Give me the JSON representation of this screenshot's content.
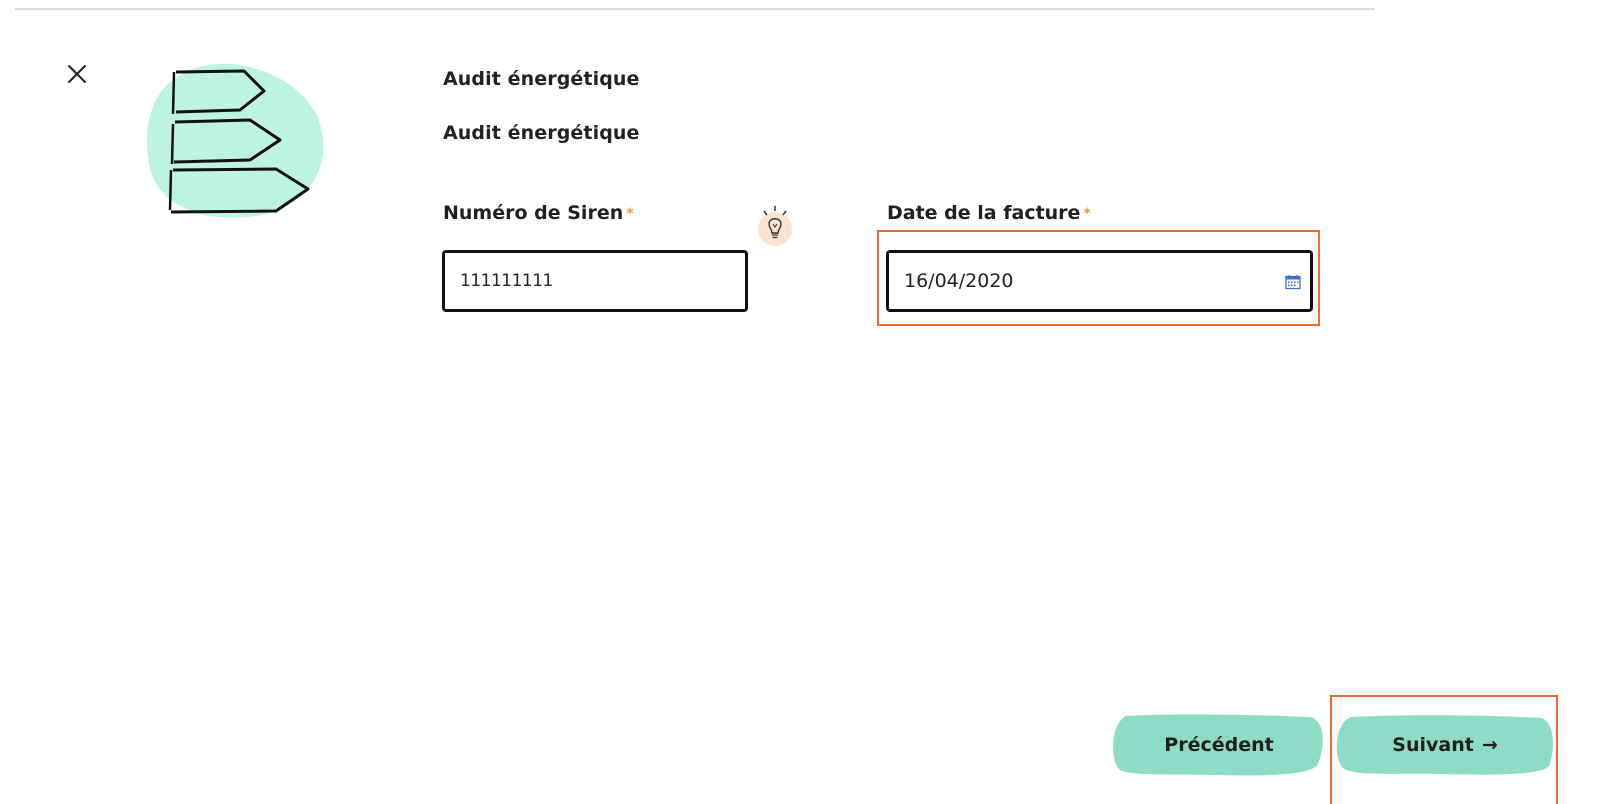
{
  "header": {
    "subtitle_primary": "Audit énergétique",
    "subtitle_secondary": "Audit énergétique"
  },
  "form": {
    "siren": {
      "label": "Numéro de Siren",
      "required_marker": "*",
      "value": "111111111"
    },
    "invoice_date": {
      "label": "Date de la facture",
      "required_marker": "*",
      "value": "16/04/2020"
    }
  },
  "footer": {
    "previous_label": "Précédent",
    "next_label": "Suivant",
    "next_arrow": "→"
  },
  "colors": {
    "accent_mint": "#8fdcc6",
    "illustration_blob": "#bdf3e2",
    "required_star": "#e39a3b",
    "focus_outline": "#ef6a33",
    "hint_bg": "#fbe3d1"
  },
  "icons": {
    "close": "close-icon",
    "hint": "lightbulb-icon",
    "calendar": "calendar-icon",
    "arrow": "arrow-right-icon"
  }
}
